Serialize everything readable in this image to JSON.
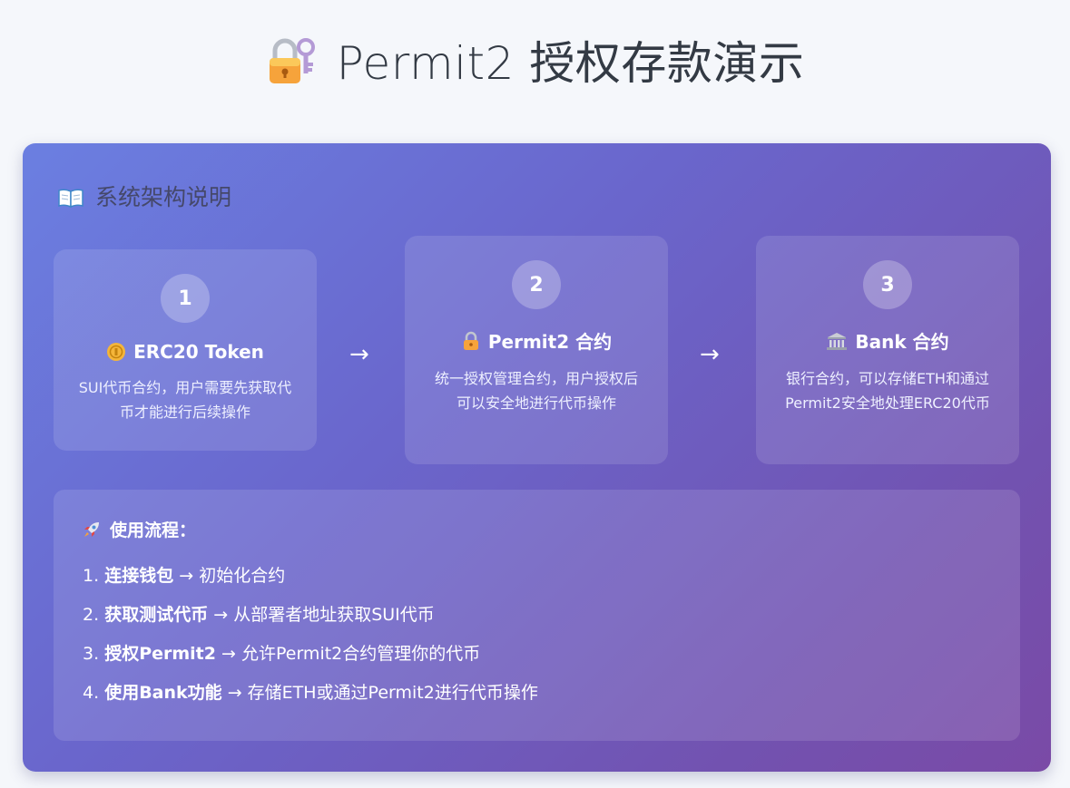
{
  "header": {
    "title": "Permit2 授权存款演示",
    "title_icon": "lock-with-key-icon"
  },
  "architecture": {
    "heading": "系统架构说明",
    "heading_icon": "open-book-icon",
    "steps": [
      {
        "number": "1",
        "icon": "coin-icon",
        "title": "ERC20 Token",
        "desc": "SUI代币合约，用户需要先获取代币才能进行后续操作"
      },
      {
        "number": "2",
        "icon": "lock-icon",
        "title": "Permit2 合约",
        "desc": "统一授权管理合约，用户授权后可以安全地进行代币操作"
      },
      {
        "number": "3",
        "icon": "bank-icon",
        "title": "Bank 合约",
        "desc": "银行合约，可以存储ETH和通过Permit2安全地处理ERC20代币"
      }
    ],
    "arrow": "→"
  },
  "usage": {
    "heading": "使用流程：",
    "heading_icon": "rocket-icon",
    "items": [
      {
        "num": "1.",
        "bold": "连接钱包",
        "rest": " → 初始化合约"
      },
      {
        "num": "2.",
        "bold": "获取测试代币",
        "rest": " → 从部署者地址获取SUI代币"
      },
      {
        "num": "3.",
        "bold": "授权Permit2",
        "rest": " → 允许Permit2合约管理你的代币"
      },
      {
        "num": "4.",
        "bold": "使用Bank功能",
        "rest": " → 存储ETH或通过Permit2进行代币操作"
      }
    ]
  },
  "colors": {
    "page_bg": "#f5f7fb",
    "panel_gradient_start": "#6b7fe1",
    "panel_gradient_end": "#7a4aa6",
    "title_text": "#333a44",
    "heading_text": "#45486a"
  }
}
